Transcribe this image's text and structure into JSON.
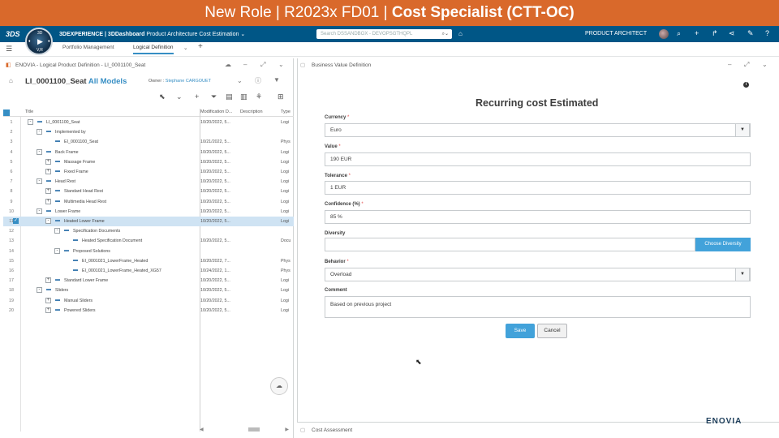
{
  "banner": {
    "prefix": "New Role | R2023x FD01 | ",
    "bold": "Cost Specialist (CTT-OC)"
  },
  "topbar": {
    "app_prefix": "3DEXPERIENCE | 3DDashboard",
    "app_name": "Product Architecture Cost Estimation",
    "search_placeholder": "Search DSSANDBOX - DEVOPSGTHQPL",
    "role": "PRODUCT ARCHITECT",
    "compass_v": "V,R",
    "compass_n": "3D",
    "compass_s": "V,R",
    "compass_w": "♦",
    "compass_e": "♦"
  },
  "tabs": [
    {
      "label": "Portfolio Management"
    },
    {
      "label": "Logical Definition"
    }
  ],
  "left_panel": {
    "header": "ENOVIA - Logical Product Definition - LI_0001100_Seat",
    "title_prefix": "LI_0001100_Seat",
    "title_suffix": "All Models",
    "owner_label": "Owner :",
    "owner_name": "Stephane CARGOUET",
    "columns": [
      "Title",
      "Modification D...",
      "Description",
      "Type"
    ],
    "rows": [
      {
        "n": "1",
        "title": "LI_0001100_Seat",
        "e": "10/20/2022, 5...",
        "type": "Logi",
        "lvl": 0,
        "exp": "-",
        "sel": false
      },
      {
        "n": "2",
        "title": "Implemented by",
        "e": "",
        "type": "",
        "lvl": 1,
        "exp": "-",
        "sel": false
      },
      {
        "n": "3",
        "title": "EI_0001100_Seat",
        "e": "10/21/2022, 5...",
        "type": "Phys",
        "lvl": 2,
        "exp": "",
        "sel": false
      },
      {
        "n": "4",
        "title": "Back Frame",
        "e": "10/20/2022, 5...",
        "type": "Logi",
        "lvl": 1,
        "exp": "-",
        "sel": false
      },
      {
        "n": "5",
        "title": "Massage Frame",
        "e": "10/20/2022, 5...",
        "type": "Logi",
        "lvl": 2,
        "exp": "+",
        "sel": false
      },
      {
        "n": "6",
        "title": "Fixed Frame",
        "e": "10/20/2022, 5...",
        "type": "Logi",
        "lvl": 2,
        "exp": "+",
        "sel": false
      },
      {
        "n": "7",
        "title": "Head Rest",
        "e": "10/20/2022, 5...",
        "type": "Logi",
        "lvl": 1,
        "exp": "-",
        "sel": false
      },
      {
        "n": "8",
        "title": "Standard Head Rest",
        "e": "10/20/2022, 5...",
        "type": "Logi",
        "lvl": 2,
        "exp": "+",
        "sel": false
      },
      {
        "n": "9",
        "title": "Multimedia Head Rest",
        "e": "10/20/2022, 5...",
        "type": "Logi",
        "lvl": 2,
        "exp": "+",
        "sel": false
      },
      {
        "n": "10",
        "title": "Lower Frame",
        "e": "10/20/2022, 5...",
        "type": "Logi",
        "lvl": 1,
        "exp": "-",
        "sel": false
      },
      {
        "n": "11",
        "title": "Heated Lower Frame",
        "e": "10/20/2022, 5...",
        "type": "Logi",
        "lvl": 2,
        "exp": "-",
        "sel": true
      },
      {
        "n": "12",
        "title": "Specification Documents",
        "e": "",
        "type": "",
        "lvl": 3,
        "exp": "-",
        "sel": false
      },
      {
        "n": "13",
        "title": "Heated Specification Document",
        "e": "10/20/2022, 5...",
        "type": "Docu",
        "lvl": 4,
        "exp": "",
        "sel": false
      },
      {
        "n": "14",
        "title": "Proposed Solutions",
        "e": "",
        "type": "",
        "lvl": 3,
        "exp": "-",
        "sel": false
      },
      {
        "n": "15",
        "title": "EI_0001021_LowerFrame_Heated",
        "e": "10/20/2022, 7...",
        "type": "Phys",
        "lvl": 4,
        "exp": "",
        "sel": false
      },
      {
        "n": "16",
        "title": "EI_0001021_LowerFrame_Heated_XG57",
        "e": "10/24/2022, 1...",
        "type": "Phys",
        "lvl": 4,
        "exp": "",
        "sel": false
      },
      {
        "n": "17",
        "title": "Standard Lower Frame",
        "e": "10/20/2022, 5...",
        "type": "Logi",
        "lvl": 2,
        "exp": "+",
        "sel": false
      },
      {
        "n": "18",
        "title": "Sliders",
        "e": "10/20/2022, 5...",
        "type": "Logi",
        "lvl": 1,
        "exp": "-",
        "sel": false
      },
      {
        "n": "19",
        "title": "Manual Sliders",
        "e": "10/20/2022, 5...",
        "type": "Logi",
        "lvl": 2,
        "exp": "+",
        "sel": false
      },
      {
        "n": "20",
        "title": "Powered Sliders",
        "e": "10/20/2022, 5...",
        "type": "Logi",
        "lvl": 2,
        "exp": "+",
        "sel": false
      }
    ]
  },
  "right_panel": {
    "header": "Business Value Definition",
    "form_title": "Recurring cost Estimated",
    "currency": {
      "label": "Currency",
      "req": " *",
      "value": "Euro"
    },
    "value": {
      "label": "Value",
      "req": " *",
      "value": "190 EUR"
    },
    "tolerance": {
      "label": "Tolerance",
      "req": " *",
      "value": "1 EUR"
    },
    "confidence": {
      "label": "Confidence (%)",
      "req": " *",
      "value": "85 %"
    },
    "diversity": {
      "label": "Diversity",
      "value": "",
      "button": "Choose Diversity"
    },
    "behavior": {
      "label": "Behavior",
      "req": " *",
      "value": "Overload"
    },
    "comment": {
      "label": "Comment",
      "value": "Based on previous project"
    },
    "save": "Save",
    "cancel": "Cancel"
  },
  "bottom_panel": {
    "header": "Cost Assessment"
  },
  "footer_logo": "ENOVIA"
}
